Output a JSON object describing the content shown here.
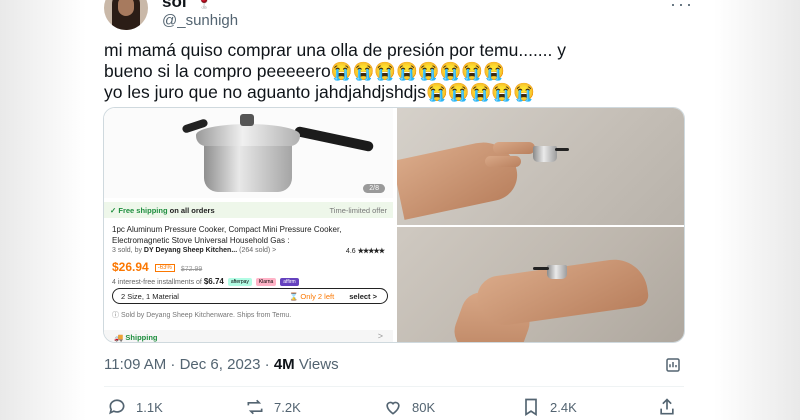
{
  "tweet": {
    "author": {
      "name": "sol",
      "name_emoji": "🍷",
      "handle": "@_sunhigh",
      "avatar": "avatar-photo"
    },
    "more_icon": "more-icon",
    "text_lines": [
      "mi mamá quiso comprar una olla de presión por temu....... y",
      "bueno si la compro peeeeero😭😭😭😭😭😭😭😭",
      "yo les juro que no aguanto  jahdjahdjshdjs😭😭😭😭😭"
    ],
    "timestamp": "11:09 AM · Dec 6, 2023 · ",
    "views_count": "4M",
    "views_label": " Views",
    "stats": {
      "replies": "1.1K",
      "reposts": "7.2K",
      "likes": "80K",
      "bookmarks": "2.4K"
    }
  },
  "product": {
    "page_indicator": "2/8",
    "free_shipping": "Free shipping",
    "free_shipping_suffix": " on all orders",
    "limited_offer": "Time-limited offer",
    "title": "1pc Aluminum Pressure Cooker, Compact Mini Pressure Cooker, Electromagnetic Stove Universal Household Gas :",
    "meta_sold": "3 sold, by ",
    "meta_seller": "DY Deyang Sheep Kitchen...",
    "meta_sold_count": "(264 sold) >",
    "rating": "4.6",
    "stars": "★★★★★",
    "price": "$26.94",
    "discount": "-63%",
    "old_price": "$72.99",
    "installments": "4 interest-free installments of ",
    "installment_amount": "$6.74",
    "pay_methods": [
      "afterpay",
      "Klarna",
      "affirm"
    ],
    "variant_label": "2 Size, 1 Material",
    "stock_label": "⌛ Only 2 left",
    "select_label": "select >",
    "sold_by": "ⓘ Sold by Deyang Sheep Kitchenware. Ships from Temu.",
    "shipping_label": "🚚 Shipping",
    "shipping_chevron": ">"
  },
  "colors": {
    "accent_orange": "#fb7701",
    "shipping_green": "#1e8e3e",
    "text_secondary": "#536471"
  }
}
